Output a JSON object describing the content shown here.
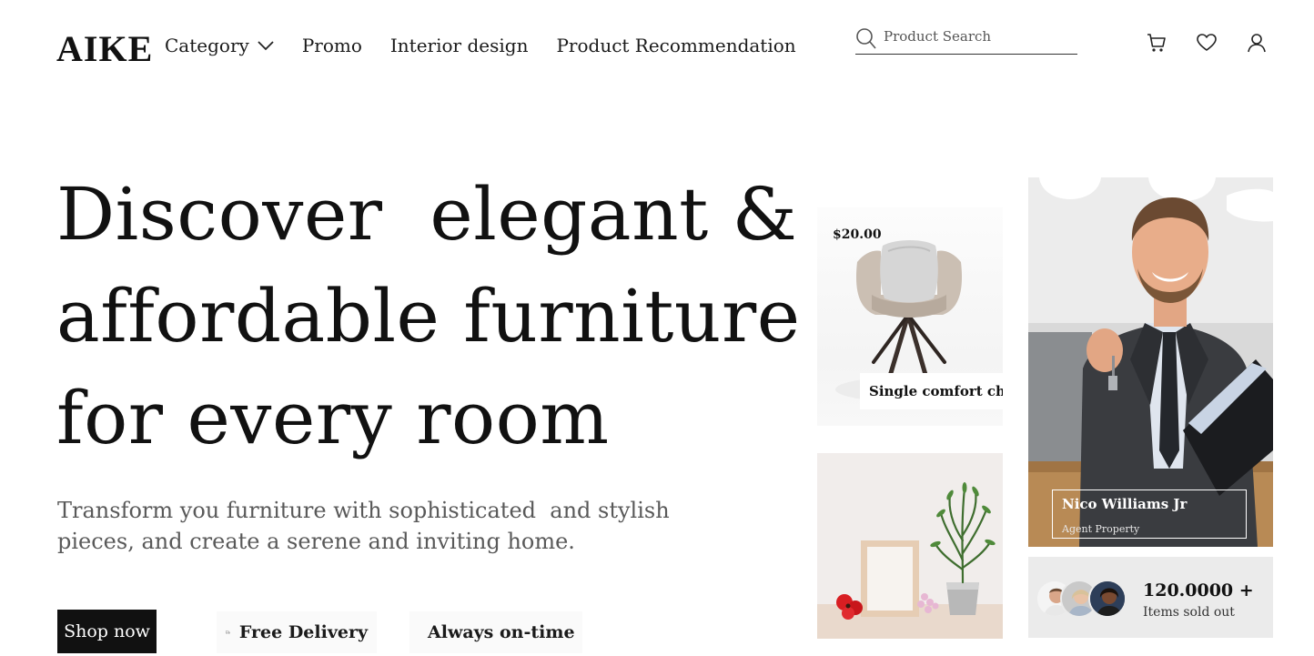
{
  "header": {
    "logo": "AIKE",
    "nav": [
      {
        "label": "Category",
        "has_dropdown": true
      },
      {
        "label": "Promo"
      },
      {
        "label": "Interior design"
      },
      {
        "label": "Product Recommendation"
      }
    ],
    "search": {
      "placeholder": "Product Search",
      "value": ""
    },
    "icons": [
      "search-icon",
      "cart-icon",
      "heart-icon",
      "user-icon"
    ]
  },
  "hero": {
    "title_lines": [
      "Discover  elegant &",
      "affordable furniture",
      "for every room"
    ],
    "subtitle_lines": [
      "Transform you furniture with sophisticated  and stylish",
      "pieces, and create a serene and inviting home."
    ],
    "cta": "Shop now",
    "features": [
      {
        "icon": "truck-icon",
        "label": "Free Delivery"
      },
      {
        "icon": "stopwatch-icon",
        "label": "Always on-time"
      }
    ]
  },
  "products": {
    "chair": {
      "price": "$20.00",
      "name": "Single comfort chair"
    }
  },
  "agent": {
    "name": "Nico Williams Jr",
    "role": "Agent Property"
  },
  "stats": {
    "value": "120.0000 +",
    "label": "Items sold out"
  },
  "colors": {
    "primary": "#111111",
    "text_muted": "#595959",
    "card_grey": "#ebebeb",
    "accent_red": "#d81e22"
  }
}
